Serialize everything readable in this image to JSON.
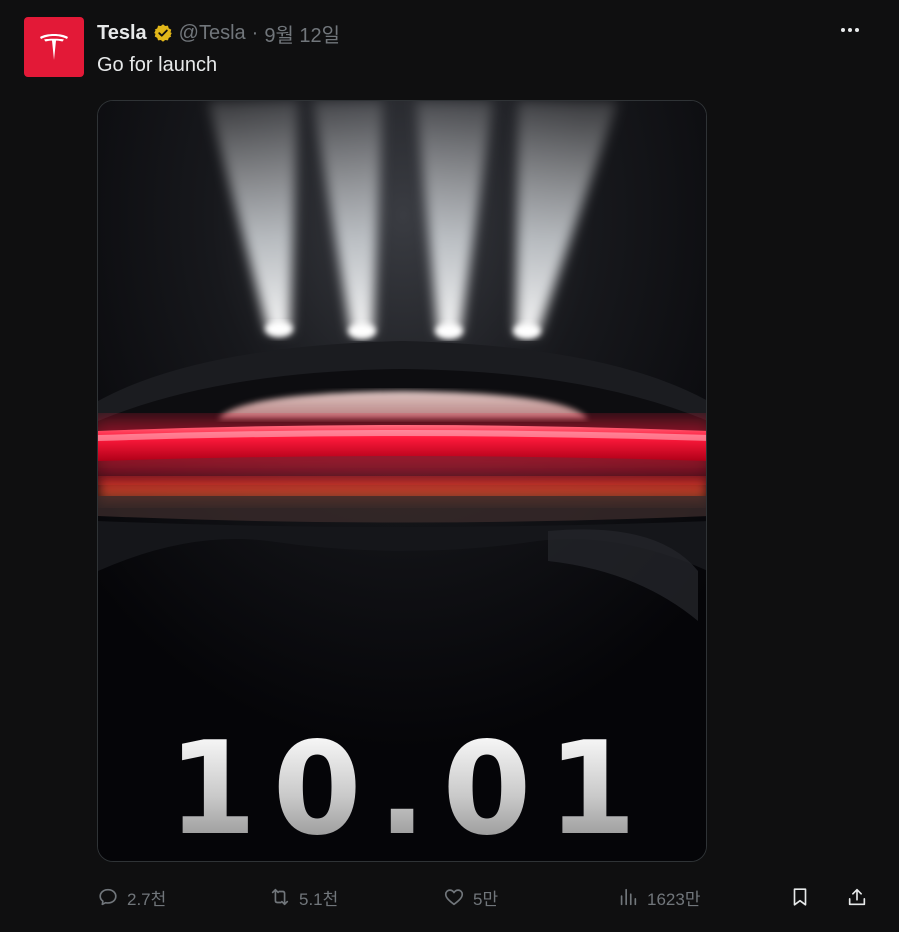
{
  "post": {
    "author_name": "Tesla",
    "handle": "@Tesla",
    "separator": "·",
    "date": "9월 12일",
    "text": "Go for launch",
    "media_text": "10.01"
  },
  "actions": {
    "replies": "2.7천",
    "reposts": "5.1천",
    "likes": "5만",
    "views": "1623만"
  },
  "colors": {
    "brand": "#e31937",
    "verified": "#e2b719",
    "background": "#0f0f10",
    "secondary_text": "#71767b",
    "taillight": "#ff1a3c"
  },
  "icons": {
    "avatar": "tesla-logo-icon",
    "verified": "verified-badge-icon",
    "more": "more-icon",
    "reply": "reply-icon",
    "repost": "repost-icon",
    "like": "heart-icon",
    "views": "views-chart-icon",
    "bookmark": "bookmark-icon",
    "share": "share-icon"
  }
}
